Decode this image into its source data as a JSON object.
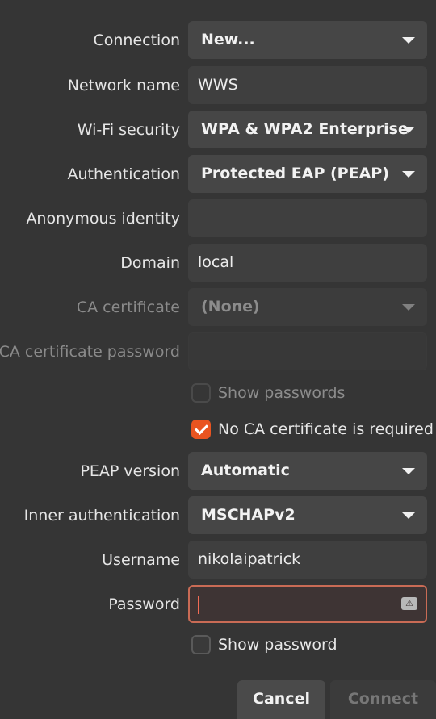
{
  "form": {
    "connection": {
      "label": "Connection",
      "value": "New..."
    },
    "network_name": {
      "label": "Network name",
      "value": "WWS"
    },
    "wifi_security": {
      "label": "Wi-Fi security",
      "value": "WPA & WPA2 Enterprise"
    },
    "authentication": {
      "label": "Authentication",
      "value": "Protected EAP (PEAP)"
    },
    "anonymous_identity": {
      "label": "Anonymous identity",
      "value": ""
    },
    "domain": {
      "label": "Domain",
      "value": "local"
    },
    "ca_certificate": {
      "label": "CA certificate",
      "value": "(None)"
    },
    "ca_certificate_password": {
      "label": "CA certificate password",
      "value": ""
    },
    "show_passwords": {
      "label": "Show passwords",
      "checked": false
    },
    "no_ca_required": {
      "label": "No CA certificate is required",
      "checked": true
    },
    "peap_version": {
      "label": "PEAP version",
      "value": "Automatic"
    },
    "inner_authentication": {
      "label": "Inner authentication",
      "value": "MSCHAPv2"
    },
    "username": {
      "label": "Username",
      "value": "nikolaipatrick"
    },
    "password": {
      "label": "Password",
      "value": "",
      "icon": "password-storage-icon"
    },
    "show_password": {
      "label": "Show password",
      "checked": false
    }
  },
  "buttons": {
    "cancel": "Cancel",
    "connect": "Connect"
  },
  "colors": {
    "accent": "#e95420",
    "focus_border": "#c96b55",
    "background": "#353535"
  }
}
